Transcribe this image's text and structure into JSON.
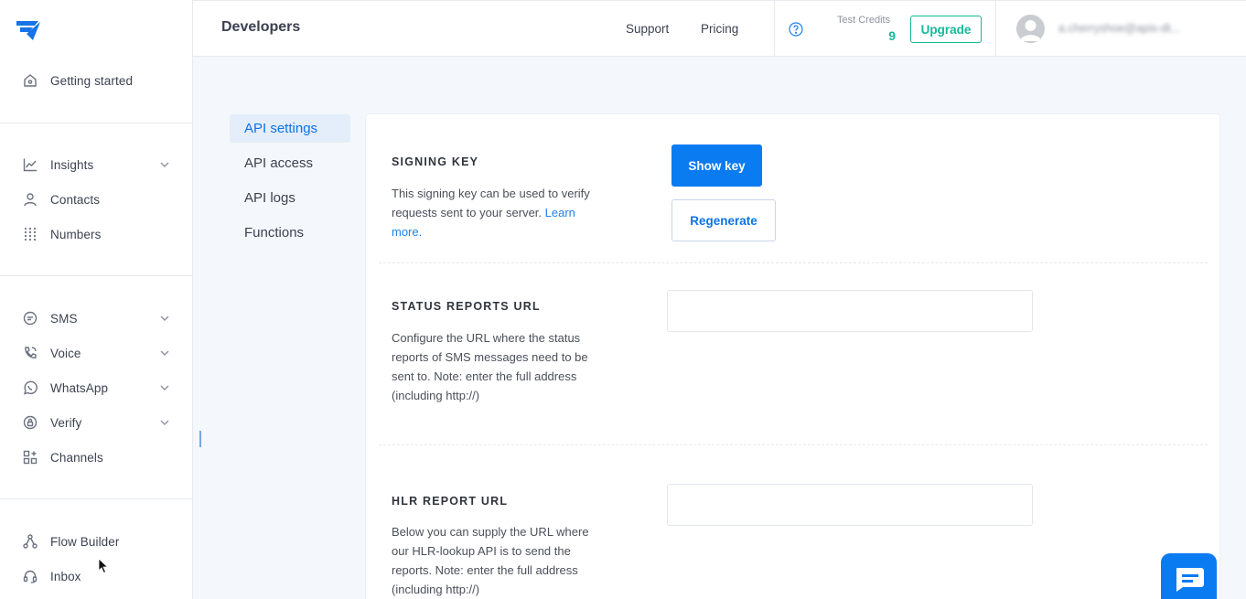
{
  "sidebar": {
    "getting_started": "Getting started",
    "insights": "Insights",
    "contacts": "Contacts",
    "numbers": "Numbers",
    "sms": "SMS",
    "voice": "Voice",
    "whatsapp": "WhatsApp",
    "verify": "Verify",
    "channels": "Channels",
    "flow_builder": "Flow Builder",
    "inbox": "Inbox"
  },
  "header": {
    "title": "Developers",
    "support": "Support",
    "pricing": "Pricing",
    "credits_label": "Test Credits",
    "credits_value": "9",
    "upgrade": "Upgrade",
    "user_email": "a.cherryshoe@apis-dt..."
  },
  "subnav": {
    "api_settings": "API settings",
    "api_access": "API access",
    "api_logs": "API logs",
    "functions": "Functions"
  },
  "signing_key": {
    "title": "SIGNING KEY",
    "desc": "This signing key can be used to verify requests sent to your server.",
    "learn_more": "Learn more.",
    "show_key": "Show key",
    "regenerate": "Regenerate"
  },
  "status_reports": {
    "title": "STATUS REPORTS URL",
    "desc": "Configure the URL where the status reports of SMS messages need to be sent to. Note: enter the full address (including http://)",
    "value": ""
  },
  "hlr_report": {
    "title": "HLR REPORT URL",
    "desc": "Below you can supply the URL where our HLR-lookup API is to send the reports. Note: enter the full address (including http://)",
    "value": ""
  },
  "colors": {
    "primary": "#0b7bf2",
    "accent_green": "#14b89a",
    "active_bg": "#e4edfa"
  },
  "icons": {
    "logo": "brand-logo-icon",
    "help": "question-circle-icon",
    "chat": "chat-bubble-icon"
  }
}
